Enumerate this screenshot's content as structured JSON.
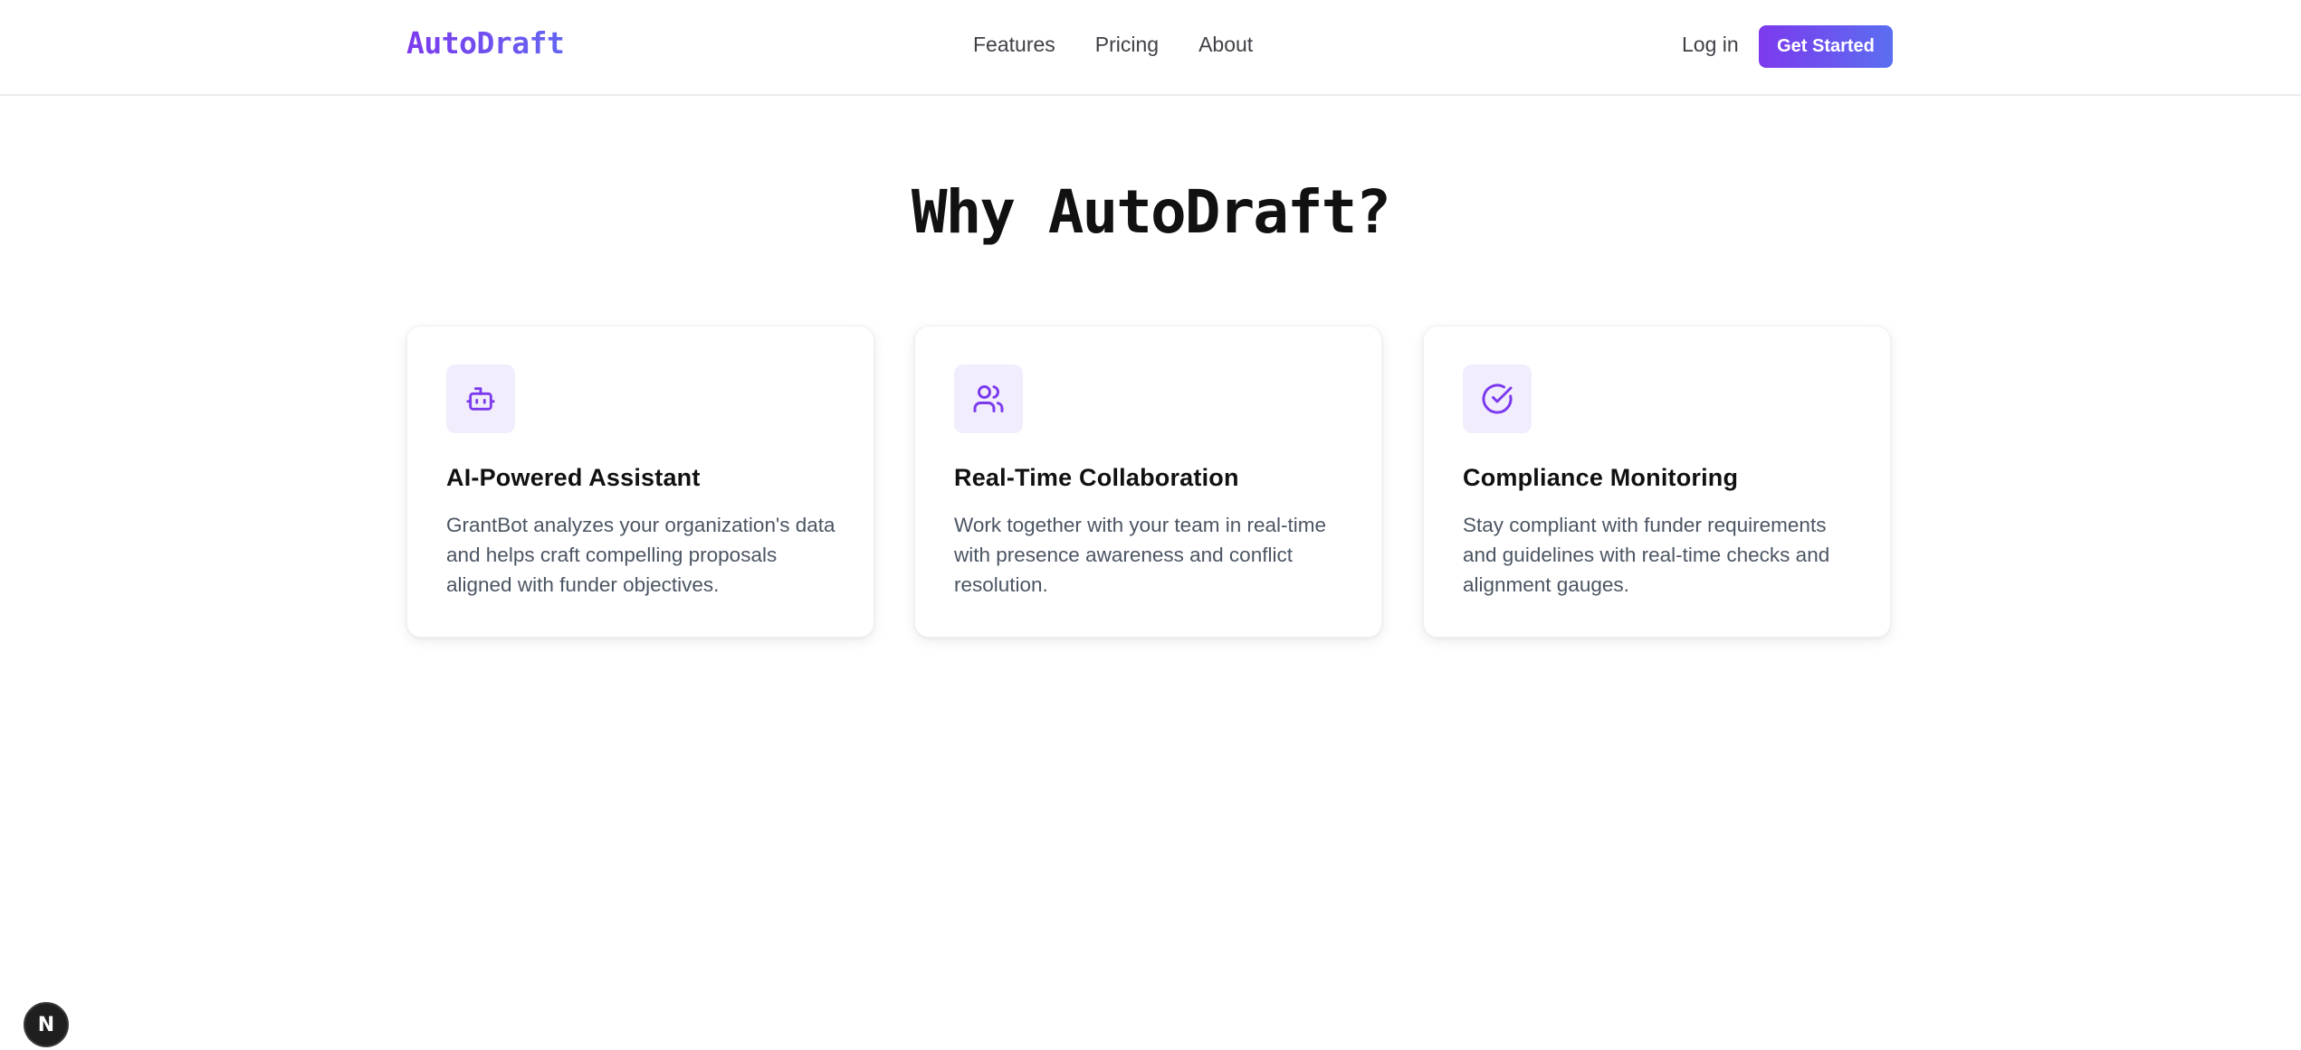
{
  "nav": {
    "logo": "AutoDraft",
    "links": [
      "Features",
      "Pricing",
      "About"
    ],
    "login": "Log in",
    "cta": "Get Started"
  },
  "section": {
    "heading": "Why AutoDraft?"
  },
  "features": [
    {
      "icon": "bot-icon",
      "title": "AI-Powered Assistant",
      "description": "GrantBot analyzes your organization's data and helps craft compelling proposals aligned with funder objectives."
    },
    {
      "icon": "users-icon",
      "title": "Real-Time Collaboration",
      "description": "Work together with your team in real-time with presence awareness and conflict resolution."
    },
    {
      "icon": "check-circle-icon",
      "title": "Compliance Monitoring",
      "description": "Stay compliant with funder requirements and guidelines with real-time checks and alignment gauges."
    }
  ],
  "dev_badge": "N",
  "colors": {
    "accent": "#7c3aed",
    "accent_gradient_end": "#5b6ef0",
    "icon_bg": "#f1edfd",
    "text_muted": "#4b5563"
  }
}
